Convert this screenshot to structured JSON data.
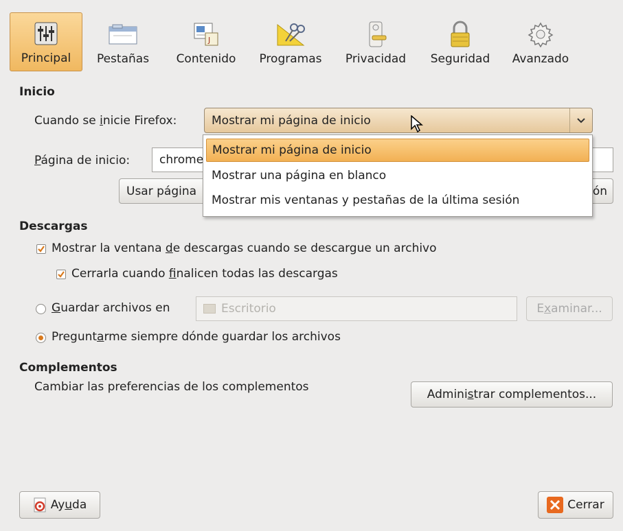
{
  "toolbar": {
    "items": [
      {
        "label": "Principal",
        "icon": "sliders-icon"
      },
      {
        "label": "Pestañas",
        "icon": "tabs-icon"
      },
      {
        "label": "Contenido",
        "icon": "content-icon"
      },
      {
        "label": "Programas",
        "icon": "programs-icon"
      },
      {
        "label": "Privacidad",
        "icon": "door-hanger-icon"
      },
      {
        "label": "Seguridad",
        "icon": "padlock-icon"
      },
      {
        "label": "Avanzado",
        "icon": "gear-icon"
      }
    ]
  },
  "inicio": {
    "title": "Inicio",
    "when_label_pre": "Cuando se ",
    "when_label_u": "i",
    "when_label_post": "nicie Firefox:",
    "when_value": "Mostrar mi página de inicio",
    "home_label_u": "P",
    "home_label_post": "ágina de inicio:",
    "home_value": "chrome",
    "use_page_button": "Usar página",
    "restore_button_tail": "ón",
    "options": [
      "Mostrar mi página de inicio",
      "Mostrar una página en blanco",
      "Mostrar mis ventanas y pestañas de la última sesión"
    ]
  },
  "descargas": {
    "title": "Descargas",
    "show_window_pre": "Mostrar la ventana ",
    "show_window_u": "d",
    "show_window_post": "e descargas cuando se descargue un archivo",
    "close_pre": "Cerrarla cuando ",
    "close_u": "f",
    "close_post": "inalicen todas las descargas",
    "save_u": "G",
    "save_post": "uardar archivos en",
    "folder_value": "Escritorio",
    "browse_pre": "E",
    "browse_u": "x",
    "browse_post": "aminar...",
    "ask_pre": "Pregunt",
    "ask_u": "a",
    "ask_post": "rme siempre dónde guardar los archivos"
  },
  "complementos": {
    "title": "Complementos",
    "desc": "Cambiar las preferencias de los complementos",
    "manage_pre": "Admini",
    "manage_u": "s",
    "manage_post": "trar complementos..."
  },
  "footer": {
    "help_pre": "Ay",
    "help_u": "u",
    "help_post": "da",
    "close": "Cerrar"
  }
}
